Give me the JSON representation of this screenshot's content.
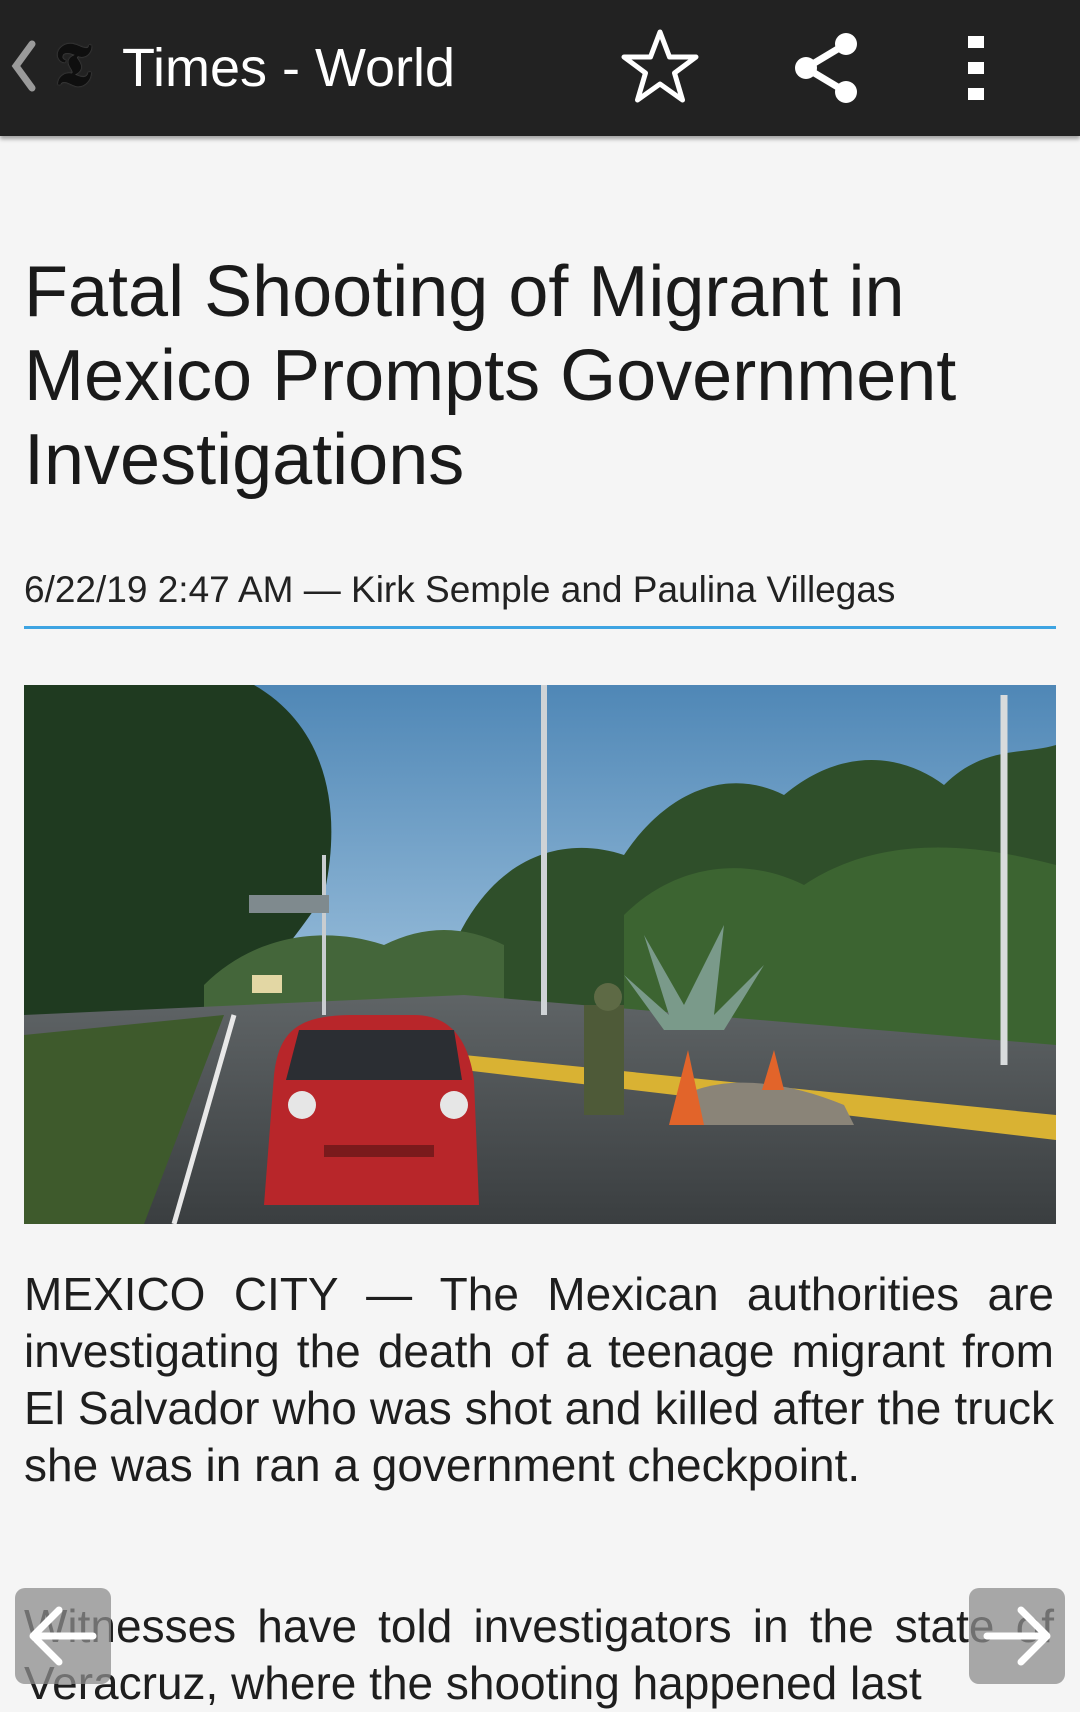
{
  "appbar": {
    "title": "Times - World",
    "logo_glyph": "𝕿",
    "icons": [
      "back-chevron-icon",
      "nyt-logo-icon",
      "star-icon",
      "share-icon",
      "more-vert-icon"
    ]
  },
  "article": {
    "headline": "Fatal Shooting of Migrant in Mexico Prompts Government Investigations",
    "byline": "6/22/19 2:47 AM — Kirk Semple and Paulina Villegas",
    "paragraphs": [
      "MEXICO CITY — The Mexican authorities are investigating the death of a teenage migrant from El Salvador who was shot and killed after the truck she was in ran a government checkpoint.",
      "Witnesses have told investigators in the state of Veracruz, where the shooting happened last"
    ]
  },
  "nav": {
    "prev_icon": "arrow-left-icon",
    "next_icon": "arrow-right-icon"
  },
  "colors": {
    "appbar": "#222222",
    "accent_rule": "#3ea4e2",
    "background": "#f5f5f5"
  }
}
